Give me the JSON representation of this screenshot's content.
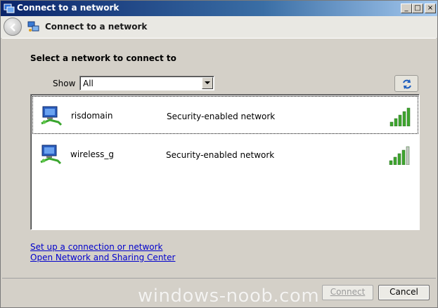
{
  "window": {
    "title": "Connect to a network",
    "controls": {
      "minimize": "_",
      "maximize": "□",
      "close": "×"
    }
  },
  "nav": {
    "title": "Connect to a network"
  },
  "main": {
    "heading": "Select a network to connect to",
    "show_label": "Show",
    "show_value": "All",
    "networks": [
      {
        "name": "risdomain",
        "security": "Security-enabled network",
        "signal_bars": 5
      },
      {
        "name": "wireless_g",
        "security": "Security-enabled network",
        "signal_bars": 4
      }
    ]
  },
  "links": {
    "setup": "Set up a connection or network",
    "sharing": "Open Network and Sharing Center"
  },
  "footer": {
    "connect_label": "Connect",
    "cancel_label": "Cancel",
    "watermark": "windows-noob.com"
  },
  "colors": {
    "title_bar": "#0a246a",
    "link": "#0000cc",
    "signal_on": "#3ea52e",
    "signal_off": "#c8c8c8"
  }
}
